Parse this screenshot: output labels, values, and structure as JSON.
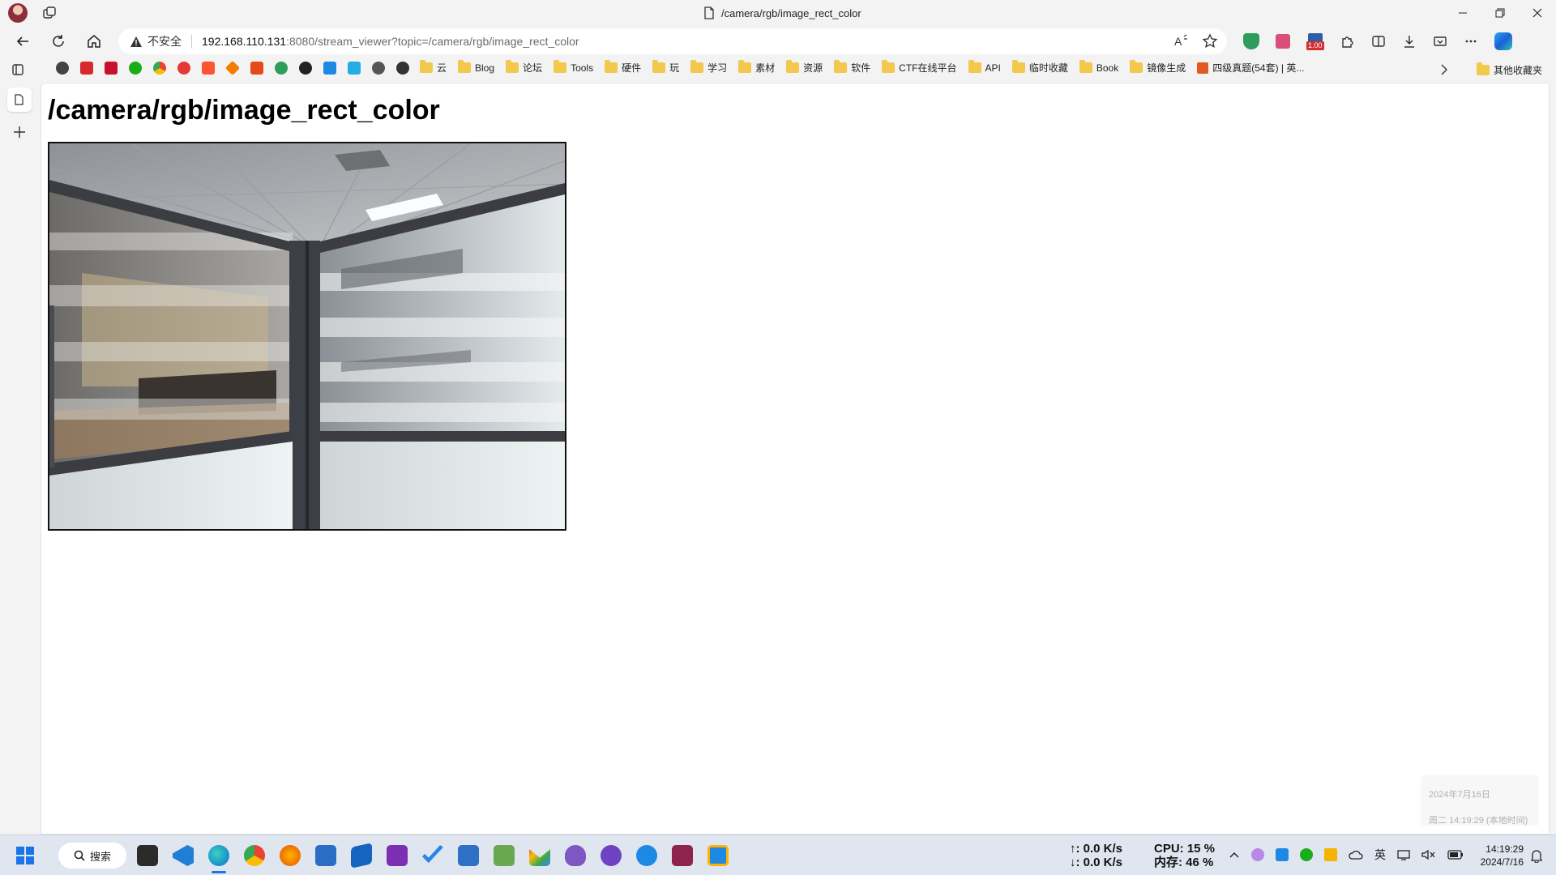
{
  "window": {
    "tab_title": "/camera/rgb/image_rect_color"
  },
  "address_bar": {
    "security_label": "不安全",
    "url_host": "192.168.110.131",
    "url_rest": ":8080/stream_viewer?topic=/camera/rgb/image_rect_color"
  },
  "extensions": {
    "badge_text": "1.00"
  },
  "bookmarks": {
    "folders": [
      "云",
      "Blog",
      "论坛",
      "Tools",
      "硬件",
      "玩",
      "学习",
      "素材",
      "资源",
      "软件",
      "CTF在线平台",
      "API",
      "临时收藏",
      "Book",
      "镜像生成"
    ],
    "page_link": "四级真题(54套) | 英...",
    "other_folder": "其他收藏夹"
  },
  "page": {
    "heading": "/camera/rgb/image_rect_color"
  },
  "notification": {
    "date": "2024年7月16日",
    "time": "周二 14:19:29 (本地时间)"
  },
  "taskbar": {
    "search_label": "搜索",
    "net_up": "↑: 0.0 K/s",
    "net_down": "↓: 0.0 K/s",
    "cpu": "CPU: 15 %",
    "mem": "内存: 46 %",
    "ime": "英",
    "clock_time": "14:19:29",
    "clock_date": "2024/7/16"
  },
  "colors": {
    "accent": "#0b5cad",
    "edge_blue": "#1a73e8",
    "folder": "#f2c94c"
  }
}
